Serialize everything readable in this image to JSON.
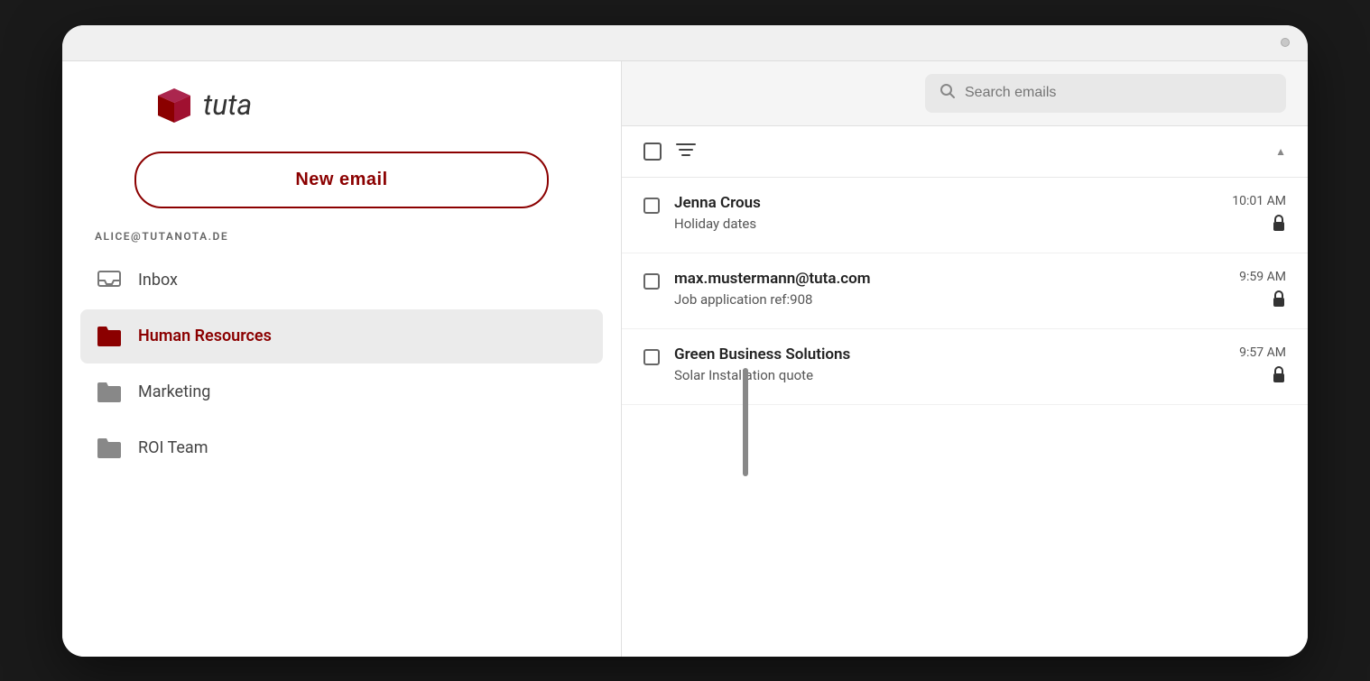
{
  "device": {
    "camera_label": "camera"
  },
  "header": {
    "search_placeholder": "Search emails"
  },
  "logo": {
    "text": "tuta"
  },
  "sidebar": {
    "new_email_label": "New email",
    "account_email": "ALICE@TUTANOTA.DE",
    "nav_items": [
      {
        "id": "inbox",
        "label": "Inbox",
        "active": false
      },
      {
        "id": "human-resources",
        "label": "Human Resources",
        "active": true
      },
      {
        "id": "marketing",
        "label": "Marketing",
        "active": false
      },
      {
        "id": "roi-team",
        "label": "ROI Team",
        "active": false
      }
    ]
  },
  "email_list": {
    "sort_indicator": "▲",
    "emails": [
      {
        "sender": "Jenna Crous",
        "subject": "Holiday dates",
        "time": "10:01 AM",
        "encrypted": true
      },
      {
        "sender": "max.mustermann@tuta.com",
        "subject": "Job application ref:908",
        "time": "9:59 AM",
        "encrypted": true
      },
      {
        "sender": "Green Business Solutions",
        "subject": "Solar Installation quote",
        "time": "9:57 AM",
        "encrypted": true
      }
    ]
  },
  "icons": {
    "inbox": "🗂",
    "folder_active": "📁",
    "folder": "📁",
    "lock": "🔒",
    "search": "🔍",
    "filter": "☰",
    "checkbox": "□"
  }
}
